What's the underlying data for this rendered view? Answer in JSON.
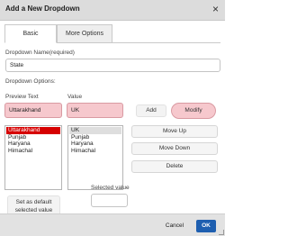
{
  "dialog": {
    "title": "Add a New Dropdown",
    "close_glyph": "×"
  },
  "tabs": [
    {
      "label": "Basic",
      "active": true
    },
    {
      "label": "More Options",
      "active": false
    }
  ],
  "fields": {
    "dropdown_name_label": "Dropdown Name(required)",
    "dropdown_name_value": "State",
    "dropdown_options_label": "Dropdown Options:",
    "preview_text_label": "Preview Text",
    "preview_text_value": "Uttarakhand",
    "value_label": "Value",
    "value_value": "UK",
    "selected_value_label": "Selected value",
    "selected_value_value": ""
  },
  "preview_list": {
    "items": [
      "Uttarakhand",
      "Punjab",
      "Haryana",
      "Himachal"
    ],
    "selected_index": 0
  },
  "value_list": {
    "items": [
      "UK",
      "Punjab",
      "Haryana",
      "Himachal"
    ],
    "selected_index": 0
  },
  "buttons": {
    "add": "Add",
    "modify": "Modify",
    "move_up": "Move Up",
    "move_down": "Move Down",
    "delete": "Delete",
    "set_default": "Set as default selected value"
  },
  "footer": {
    "cancel": "Cancel",
    "ok": "OK"
  },
  "colors": {
    "highlight_pink": "#f6c8cd",
    "selection_red": "#d60000",
    "ok_blue": "#1e5fb0"
  }
}
